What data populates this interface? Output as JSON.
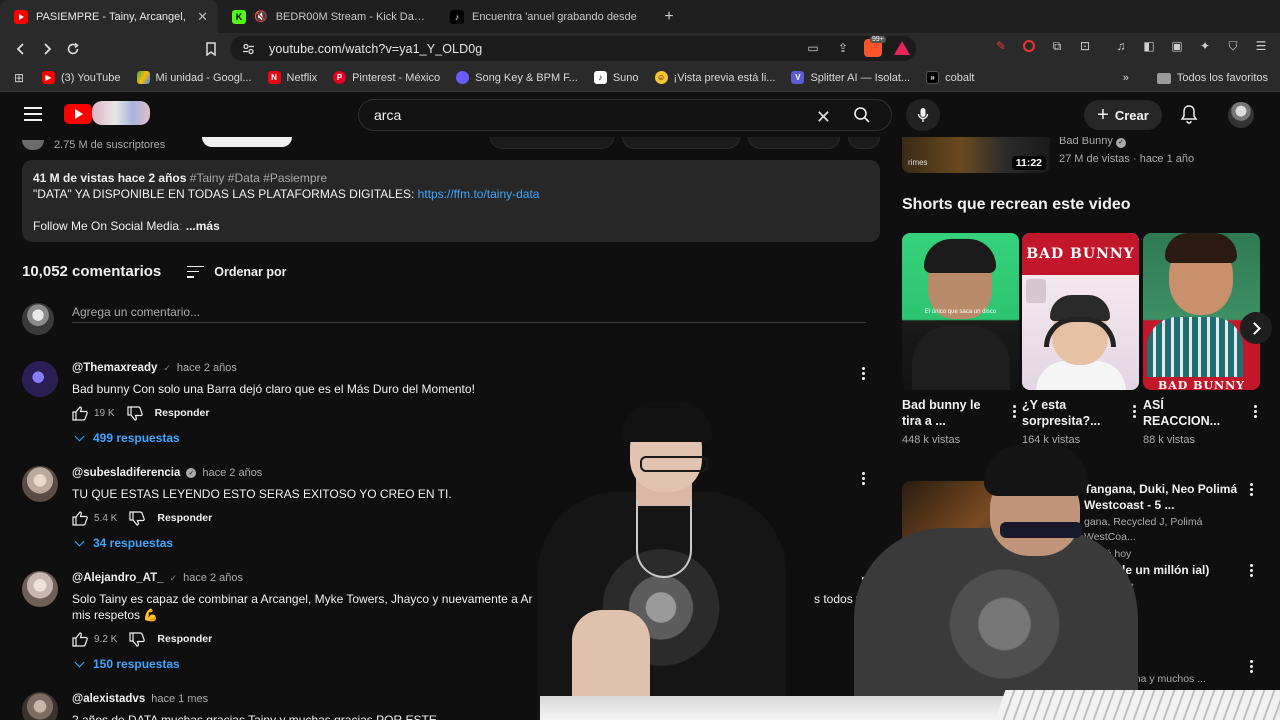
{
  "browser": {
    "tabs": [
      {
        "title": "PASIEMPRE - Tainy, Arcangel,",
        "favicon": "youtube-icon",
        "active": true
      },
      {
        "title": "BEDR00M Stream - Kick Dashb",
        "favicon": "kick-icon",
        "muted": true
      },
      {
        "title": "Encuentra 'anuel grabando desde",
        "favicon": "tiktok-icon"
      }
    ],
    "url": "youtube.com/watch?v=ya1_Y_OLD0g",
    "brave_badge": "99+",
    "bookmarks": [
      {
        "label": "(3) YouTube",
        "color": "#ff0000"
      },
      {
        "label": "Mi unidad - Googl...",
        "color": "#34a853"
      },
      {
        "label": "Netflix",
        "color": "#e50914"
      },
      {
        "label": "Pinterest - México",
        "color": "#e60023"
      },
      {
        "label": "Song Key & BPM F...",
        "color": "#6a5cff"
      },
      {
        "label": "Suno",
        "color": "#ffffff"
      },
      {
        "label": "¡Vista previa está li...",
        "color": "#f4c430"
      },
      {
        "label": "Splitter AI — Isolat...",
        "color": "#5b5bd6"
      },
      {
        "label": "cobalt",
        "color": "#000000"
      }
    ],
    "bookmarks_overflow": "»",
    "all_bookmarks": "Todos los favoritos"
  },
  "header": {
    "search_query": "arca",
    "create_label": "Crear"
  },
  "video": {
    "subscribers": "2.75 M de suscriptores",
    "description": {
      "views_date": "41 M de vistas  hace 2 años",
      "hashtags": "#Tainy #Data #Pasiempre",
      "line2_text": "\"DATA\" YA DISPONIBLE EN TODAS LAS PLATAFORMAS DIGITALES: ",
      "link": "https://ffm.to/tainy-data",
      "line3_text": "Follow Me On Social Media",
      "line3_fade": ":",
      "more": "...más"
    }
  },
  "comments": {
    "count": "10,052 comentarios",
    "sort_label": "Ordenar por",
    "add_placeholder": "Agrega un comentario...",
    "reply_label": "Responder",
    "items": [
      {
        "author": "@Themaxready",
        "time": "hace 2 años",
        "text": "Bad bunny Con solo una Barra dejó claro que es el Más Duro del Momento!",
        "likes": "19 K",
        "replies": "499 respuestas",
        "avatar": "#2a1f55"
      },
      {
        "author": "@subesladiferencia",
        "time": "hace 2 años",
        "text": "TU QUE ESTAS LEYENDO ESTO SERAS EXITOSO YO CREO EN TI.",
        "likes": "5.4 K",
        "replies": "34 respuestas",
        "avatar": "#b9a89b"
      },
      {
        "author": "@Alejandro_AT_",
        "time": "hace 2 años",
        "text": "Solo Tainy es capaz de combinar a Arcangel, Myke Towers, Jhayco y nuevamente a Ar",
        "text_tail": "s todos y",
        "text2": "mis respetos 💪",
        "likes": "9.2 K",
        "replies": "150 respuestas",
        "avatar": "#c7b7b0"
      },
      {
        "author": "@alexistadvs",
        "time": "hace 1 mes",
        "text": "2 años de DATA muchas gracias Tainy y muchas gracias POR ESTE",
        "avatar": "#7d6c62"
      }
    ]
  },
  "sidebar": {
    "prev_video": {
      "channel": "Bad Bunny",
      "meta": "27 M de vistas · hace 1 año",
      "duration": "11:22",
      "thumb_tag": "rimes"
    },
    "shorts_title": "Shorts que recrean este video",
    "shorts": [
      {
        "title": "Bad bunny le tira a ...",
        "views": "448 k vistas",
        "caption": "El único que saca un disco"
      },
      {
        "title": "¿Y esta sorpresita?...",
        "views": "164 k vistas",
        "banner": "BAD BUNNY"
      },
      {
        "title": "ASÍ REACCION...",
        "views": "88 k vistas",
        "banner": "BAD BUNNY"
      }
    ],
    "recs": [
      {
        "title": "Tangana, Duki, Neo Polimá Westcoast - 5 ...",
        "meta1": "gana, Recycled J, Polimá WestCoa...",
        "meta2": "ualizó hoy"
      },
      {
        "title": "ce - Vale un millón ial)",
        "meta1": "ertainment",
        "meta2": "4 horas"
      },
      {
        "title": "",
        "meta1": "Block, Ozuna y muchos ...",
        "meta2": ""
      }
    ]
  }
}
